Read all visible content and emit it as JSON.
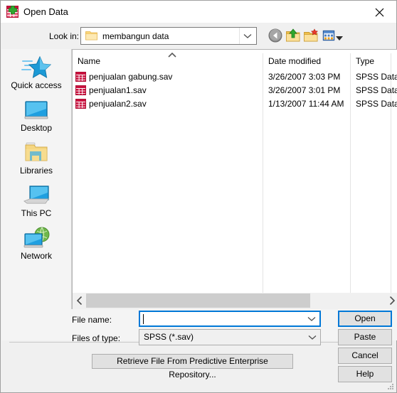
{
  "window": {
    "title": "Open Data",
    "icon": "spss-data-icon",
    "close_label": "✕"
  },
  "toolbar": {
    "lookin_label": "Look in:",
    "lookin_value": "membangun data",
    "buttons": [
      {
        "name": "back-button",
        "icon": "back-arrow-icon",
        "label": "Back"
      },
      {
        "name": "up-one-level-button",
        "icon": "up-folder-icon",
        "label": "Up One Level"
      },
      {
        "name": "create-new-folder-button",
        "icon": "new-folder-icon",
        "label": "Create New Folder"
      },
      {
        "name": "views-button",
        "icon": "views-grid-icon",
        "label": "Views"
      }
    ]
  },
  "sidebar": {
    "items": [
      {
        "label": "Quick access",
        "icon": "quick-access-star-icon"
      },
      {
        "label": "Desktop",
        "icon": "desktop-monitor-icon"
      },
      {
        "label": "Libraries",
        "icon": "libraries-folder-icon"
      },
      {
        "label": "This PC",
        "icon": "this-pc-laptop-icon"
      },
      {
        "label": "Network",
        "icon": "network-globe-icon"
      }
    ]
  },
  "file_list": {
    "sort_column": "Name",
    "sort_direction": "ascending",
    "columns": [
      "Name",
      "Date modified",
      "Type"
    ],
    "rows": [
      {
        "name": "penjualan gabung.sav",
        "date_modified": "3/26/2007 3:03 PM",
        "type": "SPSS Data",
        "icon": "spss-data-file-icon"
      },
      {
        "name": "penjualan1.sav",
        "date_modified": "3/26/2007 3:01 PM",
        "type": "SPSS Data",
        "icon": "spss-data-file-icon"
      },
      {
        "name": "penjualan2.sav",
        "date_modified": "1/13/2007 11:44 AM",
        "type": "SPSS Data",
        "icon": "spss-data-file-icon"
      }
    ]
  },
  "scrollbar": {
    "left_arrow": "‹",
    "right_arrow": "›"
  },
  "form": {
    "filename_label": "File name:",
    "filename_value": "",
    "filename_placeholder": "",
    "filetype_label": "Files of type:",
    "filetype_value": "SPSS (*.sav)",
    "filetype_options": [
      "SPSS (*.sav)"
    ]
  },
  "buttons": {
    "open": "Open",
    "paste": "Paste",
    "cancel": "Cancel",
    "help": "Help",
    "retrieve": "Retrieve File From Predictive Enterprise Repository..."
  },
  "colors": {
    "focus_blue": "#0078d7",
    "dialog_bg": "#f0f0f0",
    "panel_bg": "#f4f4f4",
    "button_face": "#e1e1e1",
    "spss_red": "#c9123f",
    "folder_yellow": "#fcd77a"
  }
}
